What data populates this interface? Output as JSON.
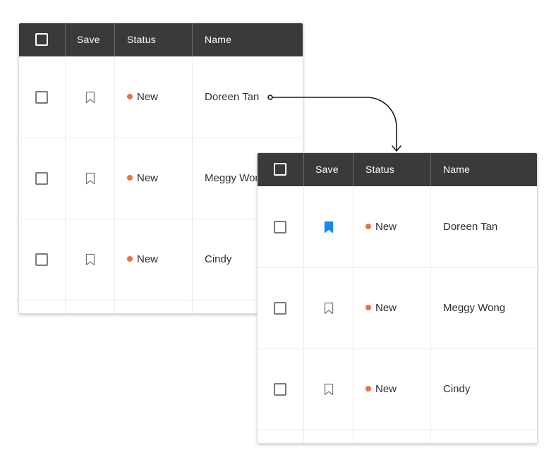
{
  "colors": {
    "header_bg": "#3a3a3c",
    "status_dot": "#e8704a",
    "bookmark_active": "#1a85f3",
    "bookmark_inactive": "#7a7a7a"
  },
  "before_table": {
    "columns": {
      "save": "Save",
      "status": "Status",
      "name": "Name"
    },
    "rows": [
      {
        "status": "New",
        "name": "Doreen Tan",
        "saved": false
      },
      {
        "status": "New",
        "name": "Meggy Wong",
        "saved": false
      },
      {
        "status": "New",
        "name": "Cindy",
        "saved": false
      }
    ]
  },
  "after_table": {
    "columns": {
      "save": "Save",
      "status": "Status",
      "name": "Name"
    },
    "rows": [
      {
        "status": "New",
        "name": "Doreen Tan",
        "saved": true
      },
      {
        "status": "New",
        "name": "Meggy Wong",
        "saved": false
      },
      {
        "status": "New",
        "name": "Cindy",
        "saved": false
      }
    ]
  }
}
